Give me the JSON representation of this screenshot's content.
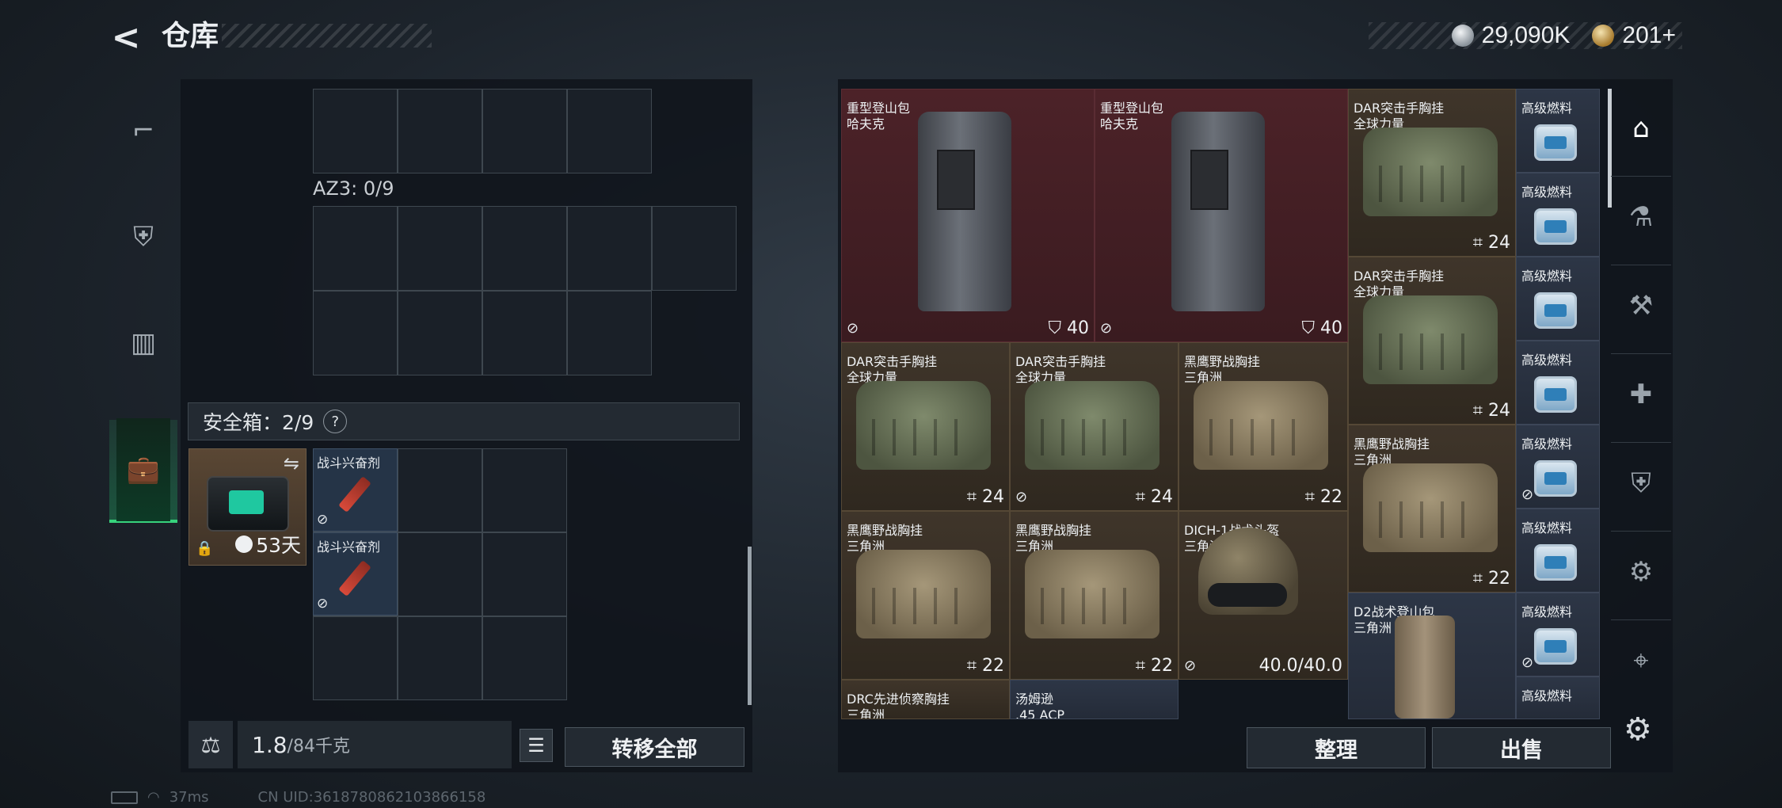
{
  "header": {
    "back_icon": "chevron-left-icon",
    "title": "仓库",
    "currency_silver": "29,090K",
    "currency_gold": "201+"
  },
  "left_tabs": [
    {
      "icon": "pistol-icon"
    },
    {
      "icon": "armor-vest-icon"
    },
    {
      "icon": "backpack-icon"
    },
    {
      "icon": "briefcase-icon",
      "active": true
    }
  ],
  "container": {
    "az3_label": "AZ3: 0/9"
  },
  "safe_box": {
    "label": "安全箱：2/9",
    "help": "?",
    "swap_icon": "swap-icon",
    "duration": "53天",
    "items": [
      {
        "name": "战斗兴奋剂"
      },
      {
        "name": "战斗兴奋剂"
      }
    ]
  },
  "left_footer": {
    "weight_value": "1.8",
    "weight_max": "/84千克",
    "transfer_all": "转移全部"
  },
  "status_bar": {
    "ping": "37ms",
    "uid": "CN UID:3618780862103866158"
  },
  "inventory": {
    "items": [
      {
        "n1": "重型登山包",
        "n2": "哈夫克",
        "count": "40"
      },
      {
        "n1": "重型登山包",
        "n2": "哈夫克",
        "count": "40"
      },
      {
        "n1": "DAR突击手胸挂",
        "n2": "全球力量",
        "count": "24"
      },
      {
        "n1": "DAR突击手胸挂",
        "n2": "全球力量",
        "count": "24"
      },
      {
        "n1": "DAR突击手胸挂",
        "n2": "全球力量",
        "count": "24"
      },
      {
        "n1": "DAR突击手胸挂",
        "n2": "全球力量",
        "count": "24"
      },
      {
        "n1": "黑鹰野战胸挂",
        "n2": "三角洲",
        "count": "22"
      },
      {
        "n1": "黑鹰野战胸挂",
        "n2": "三角洲",
        "count": "22"
      },
      {
        "n1": "黑鹰野战胸挂",
        "n2": "三角洲",
        "count": "22"
      },
      {
        "n1": "黑鹰野战胸挂",
        "n2": "三角洲",
        "count": "22"
      },
      {
        "n1": "DICH-1战术头盔",
        "n2": "三角洲",
        "count": "40.0/40.0"
      },
      {
        "n1": "D2战术登山包",
        "n2": "三角洲"
      },
      {
        "n1": "DRC先进侦察胸挂",
        "n2": "三角洲"
      },
      {
        "n1": "汤姆逊",
        "n2": ".45 ACP"
      }
    ],
    "fuel": "高级燃料"
  },
  "right_tabs": [
    {
      "icon": "storage-icon"
    },
    {
      "icon": "lab-icon"
    },
    {
      "icon": "workbench-icon"
    },
    {
      "icon": "medical-station-icon"
    },
    {
      "icon": "armory-icon"
    },
    {
      "icon": "tech-center-icon"
    },
    {
      "icon": "shooting-range-icon"
    }
  ],
  "right_footer": {
    "sort": "整理",
    "sell": "出售"
  }
}
